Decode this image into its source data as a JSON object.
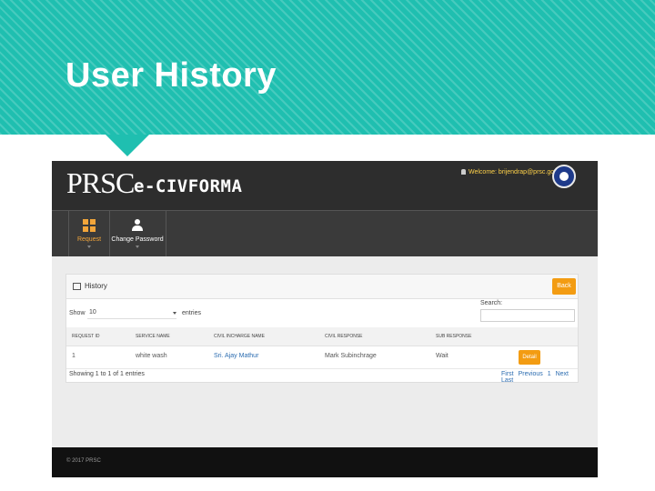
{
  "slide": {
    "title": "User History"
  },
  "app": {
    "logo": {
      "main": "PRSC",
      "sub": "e-CIVFORMA"
    },
    "user": {
      "welcome": "Welcome: brijendrap@prsc.gov.in"
    },
    "nav": [
      {
        "label": "Request",
        "icon": "grid-icon",
        "active": true
      },
      {
        "label": "Change Password",
        "icon": "user-icon",
        "active": false
      }
    ],
    "panel": {
      "title": "History",
      "back_label": "Back",
      "show_label": "Show",
      "entries_value": "10",
      "entries_label": "entries",
      "search_label": "Search:",
      "search_value": "",
      "columns": [
        "Request ID",
        "Service Name",
        "Civil Incharge Name",
        "Civil Response",
        "SUB Response"
      ],
      "rows": [
        {
          "request_id": "1",
          "service_name": "white wash",
          "civil_incharge": "Sri. Ajay Mathur",
          "civil_response": "Mark Subinchrage",
          "sub_response": "Wait",
          "action_label": "Detail"
        }
      ],
      "showing_text": "Showing 1 to 1 of 1 entries",
      "pagination": [
        "First",
        "Previous",
        "1",
        "Next",
        "Last"
      ]
    },
    "footer": {
      "text": "© 2017 PRSC"
    }
  },
  "colors": {
    "banner": "#1fbfb0",
    "accent": "#f39c12",
    "header": "#2d2d2d",
    "link": "#2b6cb0"
  }
}
